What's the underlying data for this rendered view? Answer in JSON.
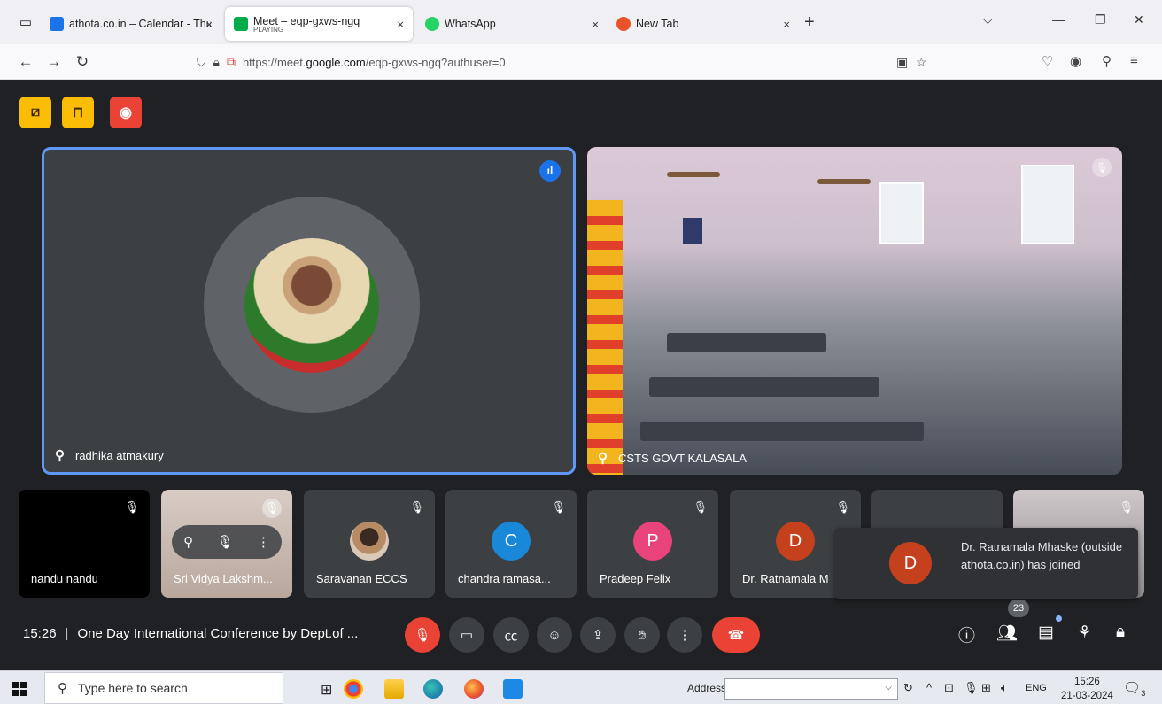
{
  "browser": {
    "tabs": [
      {
        "title": "athota.co.in – Calendar - Thurs",
        "favicon_color": "#1a73e8"
      },
      {
        "title": "Meet – eqp-gxws-ngq",
        "subtitle": "PLAYING",
        "favicon_color": "#00ac47",
        "active": true
      },
      {
        "title": "WhatsApp",
        "favicon_color": "#25d366"
      },
      {
        "title": "New Tab",
        "favicon_color": "#e8532b"
      }
    ],
    "close_glyph": "×",
    "new_tab_glyph": "+",
    "url_prefix": "https://meet.",
    "url_domain": "google.com",
    "url_path": "/eqp-gxws-ngq?authuser=0"
  },
  "meet": {
    "host_controls": [
      {
        "icon": "no-present-icon",
        "color": "#fbbc04"
      },
      {
        "icon": "exit-room-icon",
        "color": "#fbbc04"
      },
      {
        "icon": "record-icon",
        "color": "#ea4335"
      }
    ],
    "main_tiles": [
      {
        "name": "radhika atmakury",
        "speaking": true
      },
      {
        "name": "CSTS GOVT KALASALA",
        "muted": true
      }
    ],
    "strip": [
      {
        "name": "nandu nandu",
        "bg": "#000000"
      },
      {
        "name": "Sri Vidya Lakshm...",
        "bg": "#c7b9b0"
      },
      {
        "name": "Saravanan ECCS",
        "avatar": "photo"
      },
      {
        "name": "chandra ramasa...",
        "letter": "C",
        "color": "#1a88d9"
      },
      {
        "name": "Pradeep Felix",
        "letter": "P",
        "color": "#e8437a"
      },
      {
        "name": "Dr. Ratnamala M",
        "letter": "D",
        "color": "#c5411d"
      }
    ],
    "toast": {
      "letter": "D",
      "color": "#c5411d",
      "message": "Dr. Ratnamala Mhaske (outside athota.co.in) has joined"
    },
    "time": "15:26",
    "meeting_title": "One Day International Conference by Dept.of ...",
    "participants_count": "23"
  },
  "taskbar": {
    "search_placeholder": "Type here to search",
    "address_label": "Address",
    "language": "ENG",
    "clock_time": "15:26",
    "clock_date": "21-03-2024",
    "notification_count": "3"
  }
}
